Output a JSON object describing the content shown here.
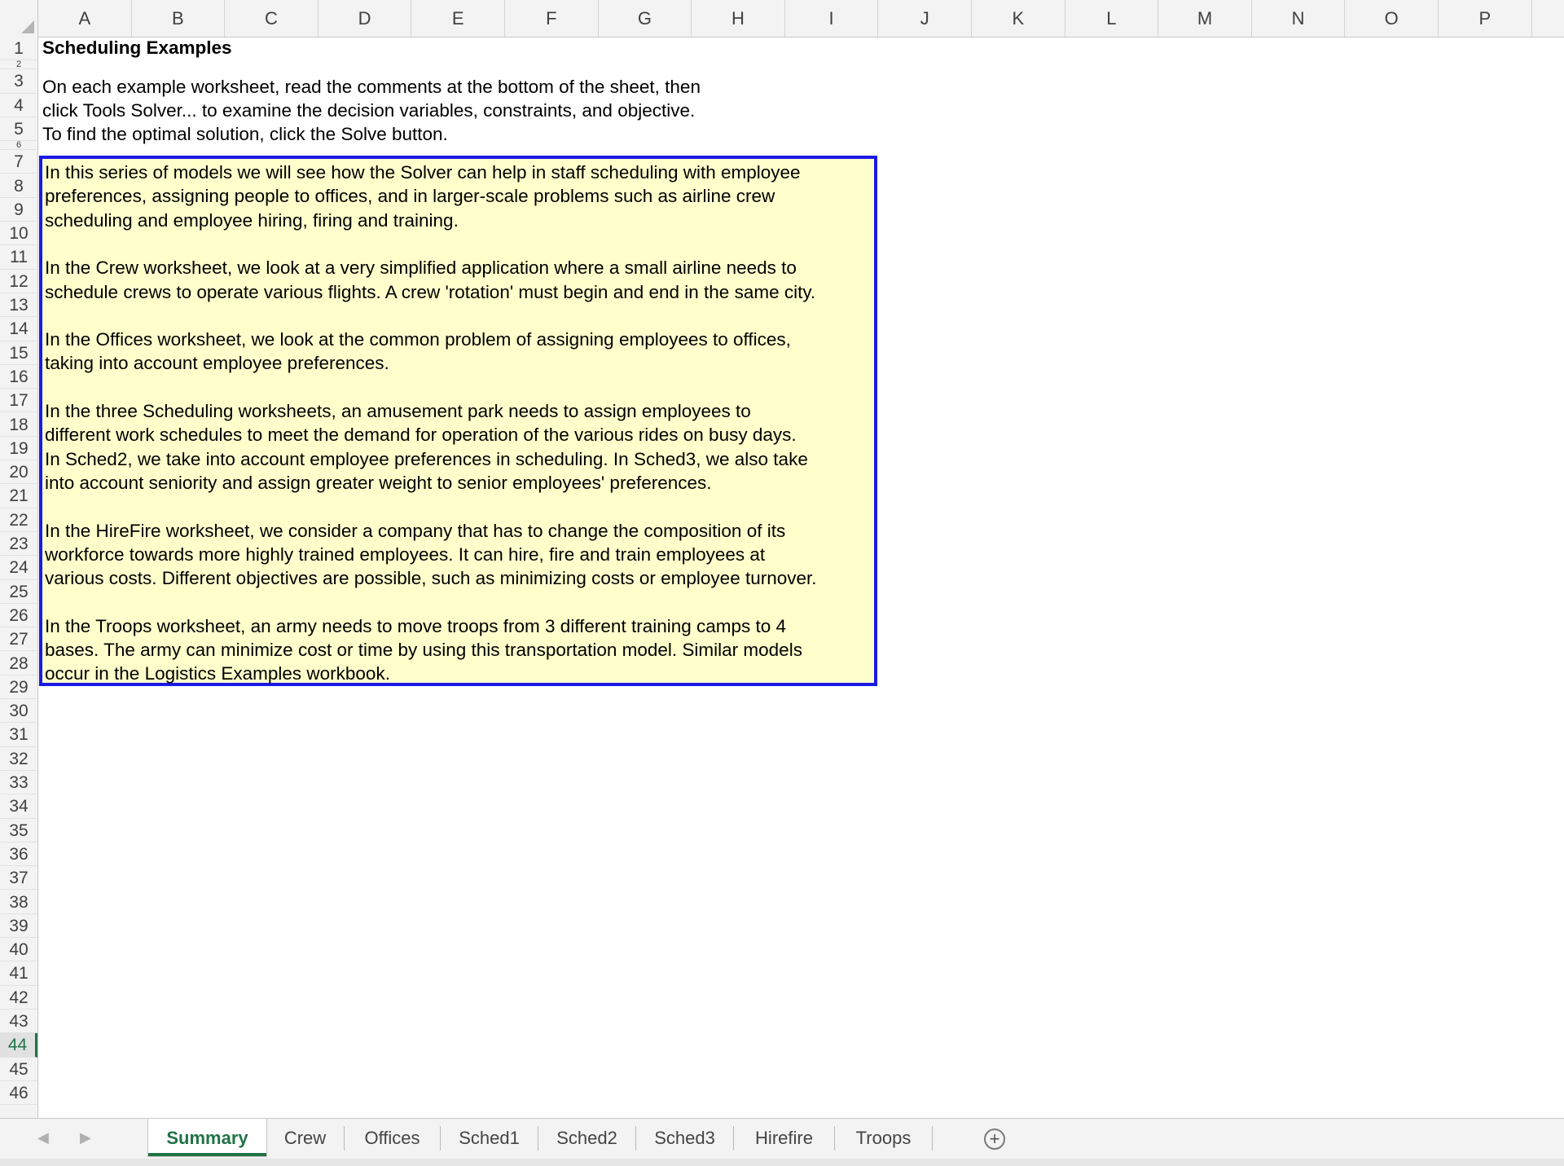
{
  "columns": [
    "A",
    "B",
    "C",
    "D",
    "E",
    "F",
    "G",
    "H",
    "I",
    "J",
    "K",
    "L",
    "M",
    "N",
    "O",
    "P"
  ],
  "rows": [
    "1",
    "2",
    "3",
    "4",
    "5",
    "6",
    "7",
    "8",
    "9",
    "10",
    "11",
    "12",
    "13",
    "14",
    "15",
    "16",
    "17",
    "18",
    "19",
    "20",
    "21",
    "22",
    "23",
    "24",
    "25",
    "26",
    "27",
    "28",
    "29",
    "30",
    "31",
    "32",
    "33",
    "34",
    "35",
    "36",
    "37",
    "38",
    "39",
    "40",
    "41",
    "42",
    "43",
    "44",
    "45",
    "46"
  ],
  "selected_row": "44",
  "cells": {
    "title": "Scheduling Examples",
    "instructions": [
      "On each example worksheet, read the comments at the bottom of the sheet, then",
      "click Tools Solver... to examine the decision variables, constraints, and objective.",
      "To find the optimal solution, click the Solve button."
    ]
  },
  "textbox": {
    "lines": [
      "In this series of models we will see how the Solver can help in staff scheduling with employee",
      "preferences, assigning people to offices, and in larger-scale problems such as airline crew",
      "scheduling and employee hiring, firing and training.",
      "",
      "In the Crew worksheet, we look at a very simplified application where a small airline needs to",
      "schedule crews to operate various flights.  A crew 'rotation' must begin and end in the same city.",
      "",
      "In the Offices worksheet, we look at the common problem of assigning employees to offices,",
      "taking into account employee preferences.",
      "",
      "In the three Scheduling worksheets, an amusement park needs to assign employees to",
      "different work schedules to meet the demand for operation of the various rides on busy days.",
      "In Sched2, we take into account employee preferences in scheduling. In Sched3, we also take",
      "into account seniority and assign greater weight to senior employees' preferences.",
      "",
      "In the HireFire worksheet, we consider a company that has to change the composition of its",
      "workforce towards more highly trained employees.  It can hire, fire and train employees at",
      "various costs.  Different objectives are possible, such as minimizing costs or employee turnover.",
      "",
      "In the Troops worksheet, an army needs to move troops from 3 different training camps to 4",
      "bases.  The army can minimize cost or time by using this transportation model.  Similar models",
      "occur in the Logistics Examples workbook."
    ]
  },
  "sheet_tabs": [
    "Summary",
    "Crew",
    "Offices",
    "Sched1",
    "Sched2",
    "Sched3",
    "Hirefire",
    "Troops"
  ],
  "active_tab": "Summary",
  "nav": {
    "prev": "◀",
    "next": "▶",
    "add": "+"
  },
  "colors": {
    "accent": "#217346",
    "textbox_fill": "#ffffcc",
    "textbox_border": "#1a1ae6"
  }
}
